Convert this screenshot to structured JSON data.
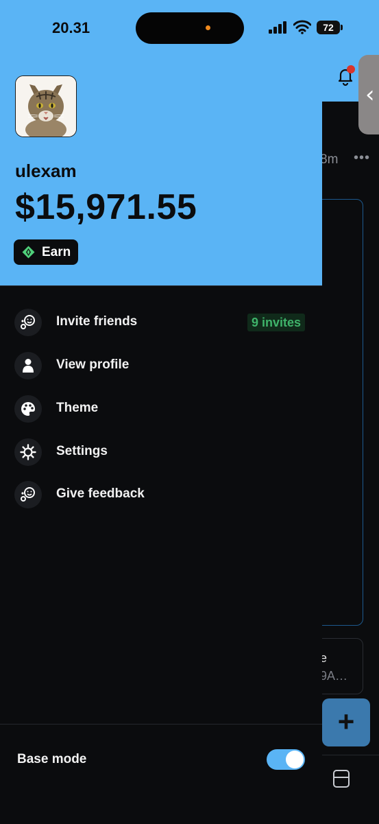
{
  "status_bar": {
    "time": "20.31",
    "battery": "72"
  },
  "background": {
    "time_fragment": "8m",
    "more_glyph": "•••",
    "card_text_line1": "e",
    "card_text_line2": "9A…",
    "fab_label": "+"
  },
  "profile": {
    "username": "ulexam",
    "balance": "$15,971.55",
    "earn_label": "Earn"
  },
  "menu": [
    {
      "label": "Invite friends",
      "icon": "invite-icon",
      "badge": "9 invites"
    },
    {
      "label": "View profile",
      "icon": "person-icon"
    },
    {
      "label": "Theme",
      "icon": "palette-icon"
    },
    {
      "label": "Settings",
      "icon": "gear-icon"
    },
    {
      "label": "Give feedback",
      "icon": "feedback-icon"
    }
  ],
  "footer": {
    "base_mode_label": "Base mode",
    "base_mode_enabled": true
  },
  "colors": {
    "accent": "#5ab4f5",
    "background": "#0b0c0e",
    "badge_green": "#3fb36a"
  }
}
